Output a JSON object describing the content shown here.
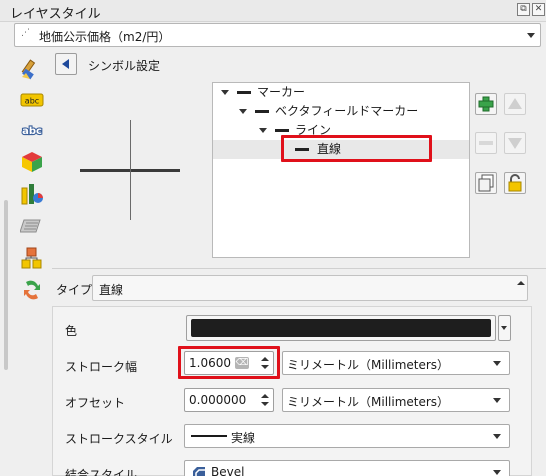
{
  "window": {
    "title": "レイヤスタイル",
    "float_btn": "⧉",
    "close_btn": "✕"
  },
  "layer": {
    "icon": "⋰",
    "name": "地価公示価格（m2/円）"
  },
  "header": {
    "symbol_settings": "シンボル設定"
  },
  "tree": {
    "items": [
      {
        "label": "マーカー",
        "level": 0
      },
      {
        "label": "ベクタフィールドマーカー",
        "level": 1
      },
      {
        "label": "ライン",
        "level": 2
      },
      {
        "label": "直線",
        "level": 3,
        "selected": true
      }
    ]
  },
  "type": {
    "label": "タイプ",
    "value": "直線"
  },
  "props": {
    "color_label": "色",
    "color_value": "#1e1e1e",
    "stroke_width_label": "ストローク幅",
    "stroke_width_value": "1.0600",
    "stroke_width_unit": "ミリメートル（Millimeters）",
    "offset_label": "オフセット",
    "offset_value": "0.000000",
    "offset_unit": "ミリメートル（Millimeters）",
    "stroke_style_label": "ストロークスタイル",
    "stroke_style_value": "実線",
    "join_style_label": "結合スタイル",
    "join_style_value": "Bevel"
  },
  "colors": {
    "highlight": "#e0101a",
    "accent": "#1f4a9c"
  }
}
